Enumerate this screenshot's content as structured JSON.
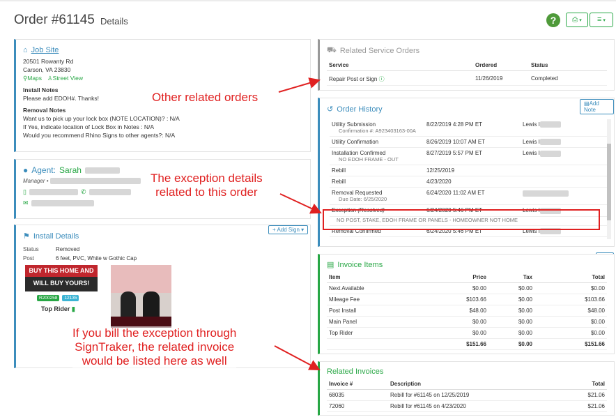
{
  "header": {
    "title": "Order #61145",
    "subtitle": "Details"
  },
  "job_site": {
    "title": "Job Site",
    "address_line1": "20501 Rowanty Rd",
    "address_line2": "Carson, VA 23830",
    "maps": "Maps",
    "street_view": "Street View",
    "install_notes_title": "Install Notes",
    "install_notes": "Please add EDOH#. Thanks!",
    "removal_notes_title": "Removal Notes",
    "removal_q1": "Want us to pick up your lock box (NOTE LOCATION)? : N/A",
    "removal_q2": "If Yes, indicate location of Lock Box in Notes : N/A",
    "removal_q3": "Would you recommend Rhino Signs to other agents?: N/A"
  },
  "agent": {
    "label": "Agent:",
    "first_name": "Sarah",
    "role": "Manager"
  },
  "install_details": {
    "title": "Install Details",
    "add_sign": "+ Add Sign",
    "status_label": "Status",
    "status_value": "Removed",
    "post_label": "Post",
    "post_value": "6 feet, PVC, White w Gothic Cap",
    "sign_line1": "BUY THIS HOME AND",
    "sign_line2": "WILL BUY YOURS!",
    "tag1": "R200258",
    "tag2": "12135",
    "top_rider": "Top Rider"
  },
  "related_service_orders": {
    "title": "Related Service Orders",
    "columns": [
      "Service",
      "Ordered",
      "Status"
    ],
    "rows": [
      {
        "service": "Repair Post or Sign",
        "ordered": "11/26/2019",
        "status": "Completed"
      }
    ]
  },
  "order_history": {
    "title": "Order History",
    "add_note": "Add Note",
    "rows": [
      {
        "event": "Utility Submission",
        "sub": "Confirmation #: A923403163-00A",
        "date": "8/22/2019 4:28 PM ET",
        "user": "Lewis I"
      },
      {
        "event": "Utility Confirmation",
        "sub": "",
        "date": "8/26/2019 10:07 AM ET",
        "user": "Lewis I"
      },
      {
        "event": "Installation Confirmed",
        "sub": "NO EDOH FRAME - OUT",
        "date": "8/27/2019 5:57 PM ET",
        "user": "Lewis I"
      },
      {
        "event": "Rebill",
        "sub": "",
        "date": "12/25/2019",
        "user": ""
      },
      {
        "event": "Rebill",
        "sub": "",
        "date": "4/23/2020",
        "user": ""
      },
      {
        "event": "Removal Requested",
        "sub": "Due Date: 6/25/2020",
        "date": "6/24/2020 11:02 AM ET",
        "user": ""
      },
      {
        "event": "Exception",
        "resolved": "(Resolved)",
        "sub": "NO POST, STAKE, EDOH FRAME OR PANELS - HOMEOWNER NOT HOME",
        "date": "6/24/2020 5:46 PM ET",
        "user": "Lewis I"
      },
      {
        "event": "Removal Confirmed",
        "sub": "",
        "date": "6/24/2020 5:46 PM ET",
        "user": "Lewis I"
      }
    ]
  },
  "invoice_items": {
    "title": "Invoice Items",
    "columns": [
      "Item",
      "Price",
      "Tax",
      "Total"
    ],
    "rows": [
      {
        "item": "Next Available",
        "price": "$0.00",
        "tax": "$0.00",
        "total": "$0.00"
      },
      {
        "item": "Mileage Fee",
        "price": "$103.66",
        "tax": "$0.00",
        "total": "$103.66"
      },
      {
        "item": "Post Install",
        "price": "$48.00",
        "tax": "$0.00",
        "total": "$48.00"
      },
      {
        "item": "Main Panel",
        "price": "$0.00",
        "tax": "$0.00",
        "total": "$0.00"
      },
      {
        "item": "Top Rider",
        "price": "$0.00",
        "tax": "$0.00",
        "total": "$0.00"
      }
    ],
    "totals": {
      "price": "$151.66",
      "tax": "$0.00",
      "total": "$151.66"
    }
  },
  "related_invoices": {
    "title": "Related Invoices",
    "columns": [
      "Invoice #",
      "Description",
      "Total"
    ],
    "rows": [
      {
        "number": "68035",
        "description": "Rebill for #61145 on 12/25/2019",
        "total": "$21.06"
      },
      {
        "number": "72060",
        "description": "Rebill for #61145 on 4/23/2020",
        "total": "$21.06"
      }
    ]
  },
  "annotations": {
    "a1": "Other related orders",
    "a2_line1": "The exception details",
    "a2_line2": "related to this order",
    "a3_line1": "If you bill the exception through",
    "a3_line2": "SignTraker, the related invoice",
    "a3_line3": "would be listed here as well"
  },
  "colors": {
    "accent": "#3c8dbc",
    "green": "#28a745",
    "annotation": "#e02020"
  }
}
